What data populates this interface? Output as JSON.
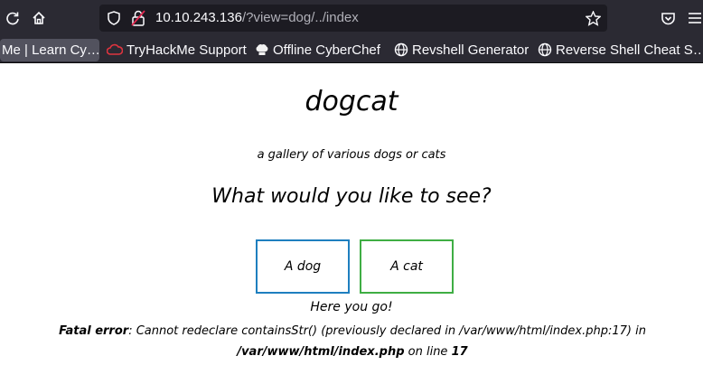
{
  "browser": {
    "url_host": "10.10.243.136",
    "url_path": "/?view=dog/../index"
  },
  "bookmarks": [
    {
      "label": "Me | Learn Cy…",
      "icon": "tab-partial"
    },
    {
      "label": "TryHackMe Support",
      "icon": "tryhackme-icon"
    },
    {
      "label": "Offline CyberChef",
      "icon": "chef-hat-icon"
    },
    {
      "label": "Revshell Generator",
      "icon": "globe-icon"
    },
    {
      "label": "Reverse Shell Cheat S…",
      "icon": "globe-icon"
    }
  ],
  "page": {
    "title": "dogcat",
    "tagline": "a gallery of various dogs or cats",
    "question": "What would you like to see?",
    "buttons": {
      "dog": "A dog",
      "cat": "A cat"
    },
    "result": "Here you go!",
    "error": {
      "label": "Fatal error",
      "message": ": Cannot redeclare containsStr() (previously declared in /var/www/html/index.php:17) in ",
      "file": "/var/www/html/index.php",
      "line_prefix": " on line ",
      "line": "17"
    }
  },
  "colors": {
    "dog_button_border": "#1e7fbf",
    "cat_button_border": "#3fae44",
    "chrome_bg": "#2b2a33",
    "urlbar_bg": "#1c1b22"
  }
}
